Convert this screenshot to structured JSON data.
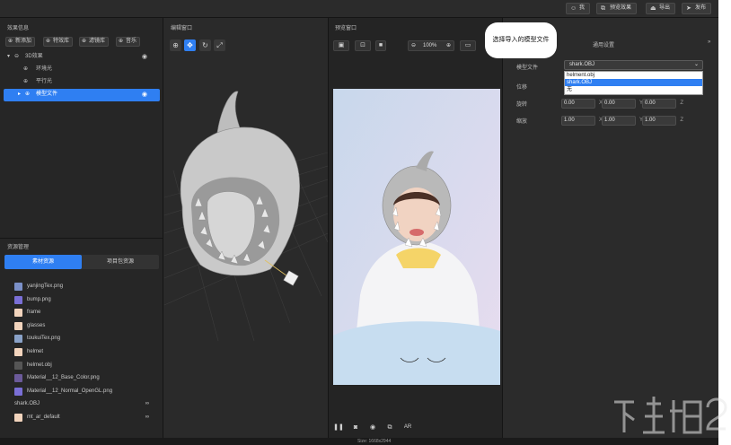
{
  "topbar": {
    "buttons": [
      {
        "label": "我",
        "icon": "user-icon"
      },
      {
        "label": "预览效果",
        "icon": "link-icon"
      },
      {
        "label": "导出",
        "icon": "export-icon"
      },
      {
        "label": "发布",
        "icon": "send-icon"
      }
    ]
  },
  "left": {
    "effects_title": "效果信息",
    "buttons": [
      {
        "label": "新添加"
      },
      {
        "label": "特效库"
      },
      {
        "label": "滤镜库"
      },
      {
        "label": "音乐"
      }
    ],
    "tree": [
      {
        "label": "3D效果"
      },
      {
        "label": "环境光"
      },
      {
        "label": "平行光"
      },
      {
        "label": "模型文件"
      }
    ],
    "resources_title": "资源管理",
    "tabs": [
      {
        "label": "素材资源"
      },
      {
        "label": "项目包资源"
      }
    ],
    "files": [
      {
        "name": "yanjingTex.png",
        "color": "#7b90c8"
      },
      {
        "name": "bump.png",
        "color": "#7a6fd6"
      },
      {
        "name": "frame",
        "color": "#f2d4bd"
      },
      {
        "name": "glasses",
        "color": "#f2d4bd"
      },
      {
        "name": "toukuiTex.png",
        "color": "#8aa2c8"
      },
      {
        "name": "helmet",
        "color": "#f2d4bd"
      },
      {
        "name": "helmet.obj",
        "color": "#555555"
      },
      {
        "name": "Material__12_Base_Color.png",
        "color": "#6b5a9a"
      },
      {
        "name": "Material__12_Normal_OpenGL.png",
        "color": "#7a6fd6"
      },
      {
        "name": "shark.OBJ",
        "color": ""
      },
      {
        "name": "mt_ar_default",
        "color": "#f2d4bd"
      }
    ]
  },
  "editor": {
    "title": "编辑窗口"
  },
  "preview": {
    "title": "预览窗口",
    "zoom": "100%",
    "status": "Size: 1668x2944"
  },
  "settings": {
    "title": "通用设置",
    "callout": "选择导入的模型文件",
    "model_label": "模型文件",
    "model_value": "shark.OBJ",
    "dropdown_options": [
      {
        "label": "helment.obj"
      },
      {
        "label": "shark.OBJ"
      },
      {
        "label": "无"
      }
    ],
    "position_label": "位移",
    "rotation_label": "旋转",
    "scale_label": "缩放",
    "rotation": {
      "x": "0.00",
      "y": "0.00",
      "z": "0.00"
    },
    "scale": {
      "x": "1.00",
      "y": "1.00",
      "z": "1.00"
    }
  },
  "colors": {
    "accent": "#2f7ff2",
    "background": "#1e1e1e"
  }
}
